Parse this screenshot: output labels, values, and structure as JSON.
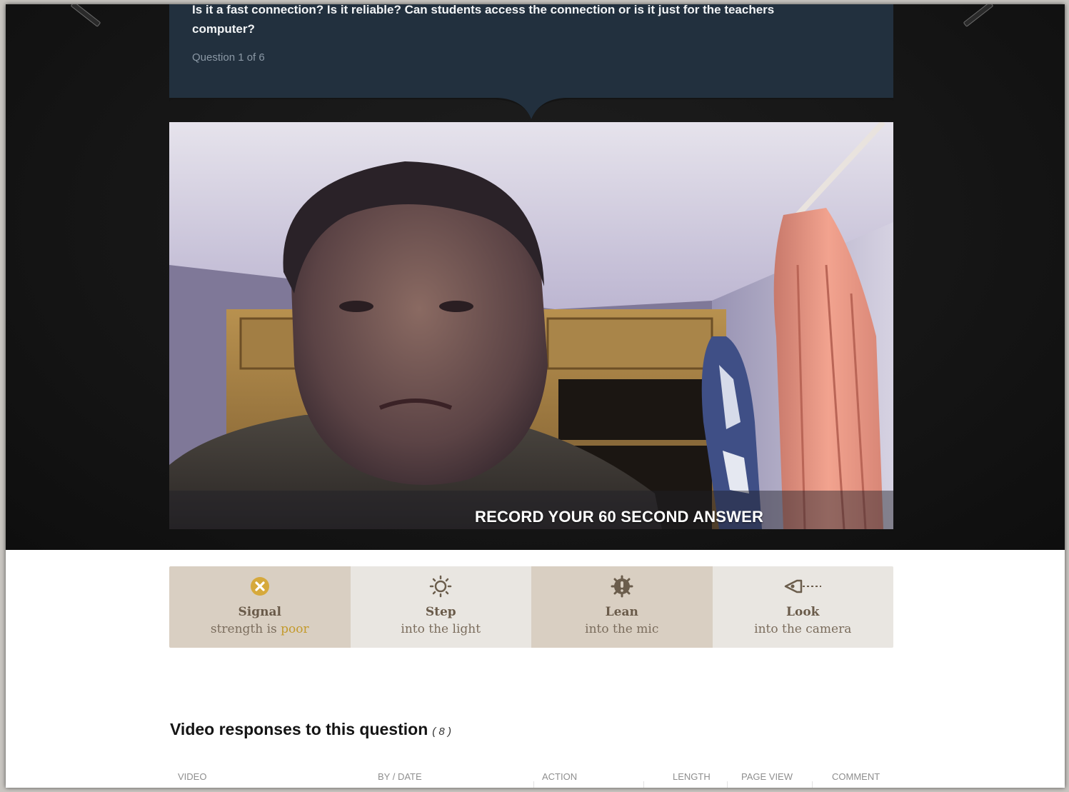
{
  "question": {
    "text": "Is it a fast connection? Is it reliable? Can students access the connection or is it just for the teachers computer?",
    "counter": "Question 1 of 6"
  },
  "video": {
    "caption": "RECORD YOUR 60 SECOND ANSWER"
  },
  "tips": [
    {
      "icon": "x-circle-icon",
      "title": "Signal",
      "sub_prefix": "strength is ",
      "sub_highlight": "poor",
      "sub": ""
    },
    {
      "icon": "sun-icon",
      "title": "Step",
      "sub": "into the light"
    },
    {
      "icon": "microphone-icon",
      "title": "Lean",
      "sub": "into the mic"
    },
    {
      "icon": "camera-icon",
      "title": "Look",
      "sub": "into the camera"
    }
  ],
  "responses": {
    "heading": "Video responses to this question",
    "count": "( 8 )",
    "columns": [
      "VIDEO",
      "BY / DATE",
      "ACTION",
      "LENGTH",
      "PAGE VIEW",
      "COMMENT"
    ]
  },
  "colors": {
    "question_panel": "#22303e",
    "tip_dark": "#d9cfc2",
    "tip_light": "#e9e6e1",
    "poor_accent": "#c39a2c"
  }
}
